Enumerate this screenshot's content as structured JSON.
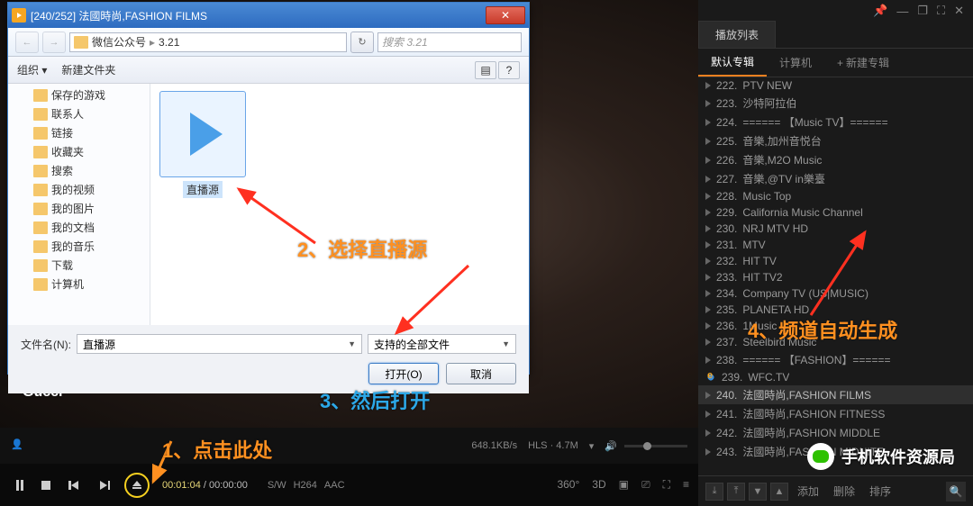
{
  "dialog": {
    "title": "[240/252] 法國時尚,FASHION FILMS",
    "breadcrumb": {
      "parent": "微信公众号",
      "current": "3.21"
    },
    "search_placeholder": "搜索 3.21",
    "toolbar": {
      "organize": "组织 ▾",
      "new_folder": "新建文件夹"
    },
    "tree": [
      "保存的游戏",
      "联系人",
      "链接",
      "收藏夹",
      "搜索",
      "我的视频",
      "我的图片",
      "我的文档",
      "我的音乐",
      "下载",
      "计算机"
    ],
    "file": {
      "name": "直播源"
    },
    "footer": {
      "filename_label": "文件名(N):",
      "filename_value": "直播源",
      "filetype_value": "支持的全部文件",
      "open": "打开(O)",
      "cancel": "取消"
    }
  },
  "gucci": "Gucci",
  "playlist": {
    "header": "播放列表",
    "subtabs": {
      "default": "默认专辑",
      "computer": "计算机",
      "new": "新建专辑"
    },
    "items": [
      {
        "n": "222",
        "t": "PTV NEW"
      },
      {
        "n": "223",
        "t": "沙特阿拉伯"
      },
      {
        "n": "224",
        "t": "====== 【Music TV】======"
      },
      {
        "n": "225",
        "t": "音樂,加州音悦台"
      },
      {
        "n": "226",
        "t": "音樂,M2O Music"
      },
      {
        "n": "227",
        "t": "音樂,@TV in樂臺"
      },
      {
        "n": "228",
        "t": "Music Top"
      },
      {
        "n": "229",
        "t": "California Music Channel"
      },
      {
        "n": "230",
        "t": "NRJ MTV HD"
      },
      {
        "n": "231",
        "t": "MTV"
      },
      {
        "n": "232",
        "t": "HIT TV"
      },
      {
        "n": "233",
        "t": "HIT TV2"
      },
      {
        "n": "234",
        "t": "Company TV (US|MUSIC)"
      },
      {
        "n": "235",
        "t": "PLANETA HD"
      },
      {
        "n": "236",
        "t": "1Music"
      },
      {
        "n": "237",
        "t": "Steelbird Music"
      },
      {
        "n": "238",
        "t": "====== 【FASHION】======"
      },
      {
        "n": "239",
        "t": "WFC.TV",
        "ie": true
      },
      {
        "n": "240",
        "t": "法國時尚,FASHION FILMS",
        "active": true
      },
      {
        "n": "241",
        "t": "法國時尚,FASHION FITNESS"
      },
      {
        "n": "242",
        "t": "法國時尚,FASHION MIDDLE"
      },
      {
        "n": "243",
        "t": "法國時尚,FASHION MIDNITE"
      }
    ],
    "bottom": {
      "add": "添加",
      "delete": "删除",
      "sort": "排序"
    }
  },
  "status": {
    "speed": "648.1KB/s",
    "hls": "HLS · 4.7M"
  },
  "controls": {
    "time_current": "00:01:04",
    "time_total": "00:00:00",
    "tags": [
      "S/W",
      "H264",
      "AAC"
    ],
    "right": [
      "360°",
      "3D"
    ]
  },
  "annotations": {
    "a1": "1、点击此处",
    "a2": "2、选择直播源",
    "a3": "3、然后打开",
    "a4": "4、频道自动生成"
  },
  "wechat": "手机软件资源局"
}
